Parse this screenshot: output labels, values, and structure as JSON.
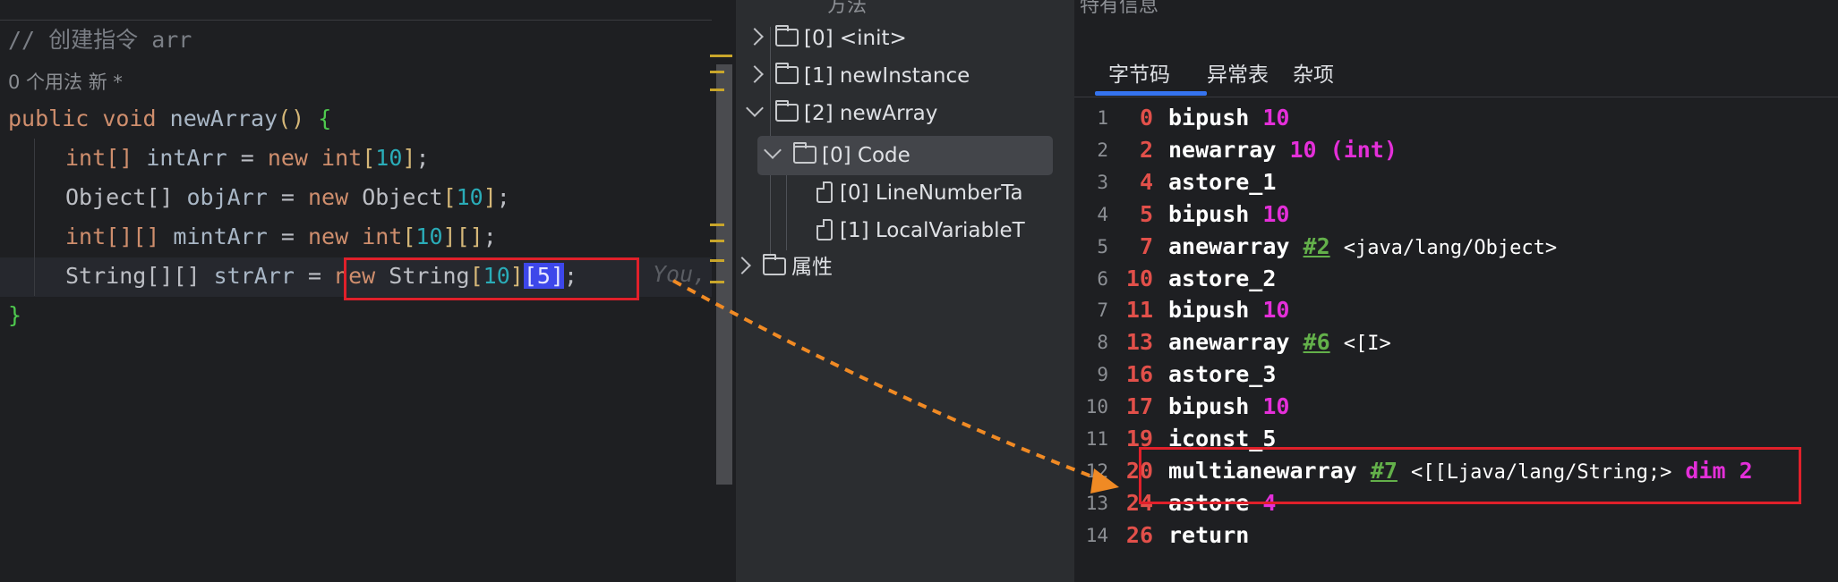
{
  "editor": {
    "comment": "// 创建指令 arr",
    "usage": "0 个用法   新 *",
    "signature": {
      "kw1": "public",
      "kw2": "void",
      "name": "newArray",
      "parens": "()",
      "brace": "{"
    },
    "lines": [
      {
        "type": "int[]",
        "var": "intArr",
        "eq": "=",
        "kw": "new",
        "rhs_type": "int",
        "dims": [
          {
            "open": "[",
            "num": "10",
            "close": "]"
          }
        ],
        "tail": ";"
      },
      {
        "type": "Object[]",
        "var": "objArr",
        "eq": "=",
        "kw": "new",
        "rhs_type": "Object",
        "dims": [
          {
            "open": "[",
            "num": "10",
            "close": "]"
          }
        ],
        "tail": ";"
      },
      {
        "type": "int[][]",
        "var": "mintArr",
        "eq": "=",
        "kw": "new",
        "rhs_type": "int",
        "dims": [
          {
            "open": "[",
            "num": "10",
            "close": "]"
          },
          {
            "open": "[",
            "num": "",
            "close": "]"
          }
        ],
        "tail": ";"
      },
      {
        "type": "String[][]",
        "var": "strArr",
        "eq": "=",
        "kw": "new",
        "rhs_type": "String",
        "dims": [
          {
            "open": "[",
            "num": "10",
            "close": "]"
          },
          {
            "open": "[",
            "num": "5",
            "close": "]"
          }
        ],
        "tail": ";"
      }
    ],
    "close_brace": "}",
    "inline_hint": "You,",
    "bottom_text": "// ..."
  },
  "tree": {
    "header": "方法",
    "items": [
      {
        "label": "[0] <init>",
        "icon": "folder-icon",
        "expanded": false
      },
      {
        "label": "[1] newInstance",
        "icon": "folder-icon",
        "expanded": false
      },
      {
        "label": "[2] newArray",
        "icon": "folder-icon",
        "expanded": true
      },
      {
        "label": "[0] Code",
        "icon": "folder-icon",
        "expanded": true,
        "selected": true
      },
      {
        "label": "[0] LineNumberTa",
        "icon": "file-icon"
      },
      {
        "label": "[1] LocalVariableT",
        "icon": "file-icon"
      },
      {
        "label": "属性",
        "icon": "folder-icon",
        "expanded": false
      }
    ]
  },
  "bytecode": {
    "header": "特有信息",
    "tabs": [
      {
        "label": "字节码",
        "active": true
      },
      {
        "label": "异常表",
        "active": false
      },
      {
        "label": "杂项",
        "active": false
      }
    ],
    "rows": [
      {
        "ln": "1",
        "off": "0",
        "op": "bipush",
        "args": [
          {
            "t": "10",
            "c": "pink"
          }
        ]
      },
      {
        "ln": "2",
        "off": "2",
        "op": "newarray",
        "args": [
          {
            "t": "10 (int)",
            "c": "pink"
          }
        ]
      },
      {
        "ln": "3",
        "off": "4",
        "op": "astore_1",
        "args": []
      },
      {
        "ln": "4",
        "off": "5",
        "op": "bipush",
        "args": [
          {
            "t": "10",
            "c": "pink"
          }
        ]
      },
      {
        "ln": "5",
        "off": "7",
        "op": "anewarray",
        "args": [
          {
            "t": "#2",
            "c": "ref"
          },
          {
            "t": "<java/lang/Object>",
            "c": "cls"
          }
        ]
      },
      {
        "ln": "6",
        "off": "10",
        "op": "astore_2",
        "args": []
      },
      {
        "ln": "7",
        "off": "11",
        "op": "bipush",
        "args": [
          {
            "t": "10",
            "c": "pink"
          }
        ]
      },
      {
        "ln": "8",
        "off": "13",
        "op": "anewarray",
        "args": [
          {
            "t": "#6",
            "c": "ref"
          },
          {
            "t": "<[I>",
            "c": "cls"
          }
        ]
      },
      {
        "ln": "9",
        "off": "16",
        "op": "astore_3",
        "args": []
      },
      {
        "ln": "10",
        "off": "17",
        "op": "bipush",
        "args": [
          {
            "t": "10",
            "c": "pink"
          }
        ]
      },
      {
        "ln": "11",
        "off": "19",
        "op": "iconst_5",
        "args": []
      },
      {
        "ln": "12",
        "off": "20",
        "op": "multianewarray",
        "args": [
          {
            "t": "#7",
            "c": "ref"
          },
          {
            "t": "<[[Ljava/lang/String;>",
            "c": "cls"
          },
          {
            "t": "dim 2",
            "c": "pink"
          }
        ]
      },
      {
        "ln": "13",
        "off": "24",
        "op": "astore",
        "args": [
          {
            "t": "4",
            "c": "pink"
          }
        ]
      },
      {
        "ln": "14",
        "off": "26",
        "op": "return",
        "args": []
      }
    ]
  },
  "colors": {
    "highlight_box": "#e0202a",
    "arrow": "#f08a24",
    "tab_underline": "#3574f0",
    "offset": "#e2504a",
    "constant": "#e42fd9",
    "reference": "#63b04a"
  }
}
